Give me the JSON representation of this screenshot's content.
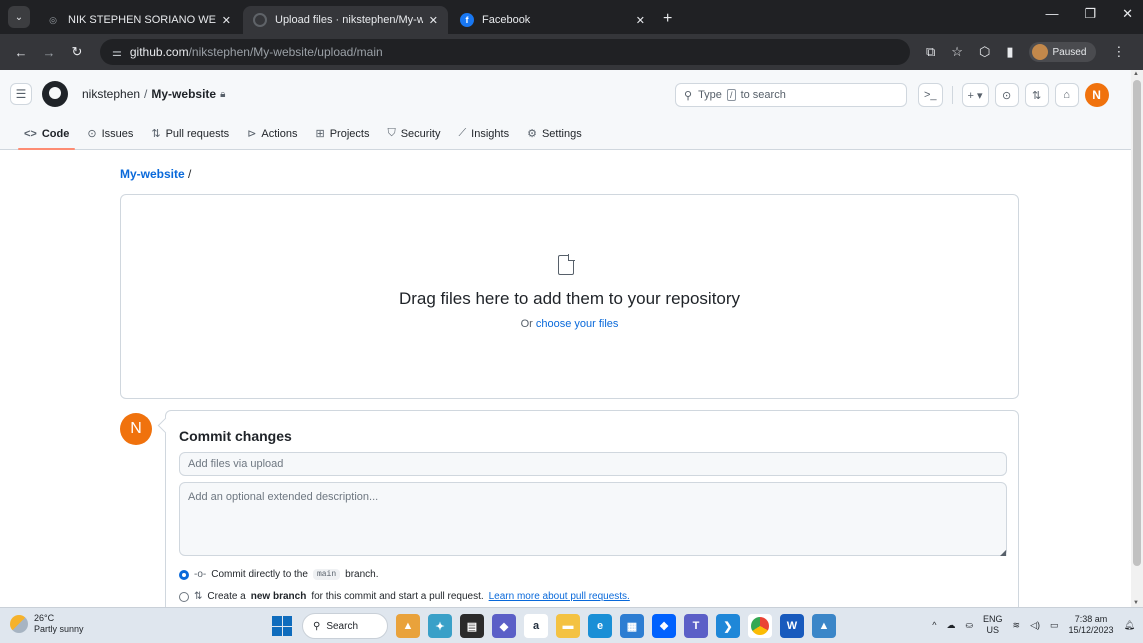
{
  "browser": {
    "tabs": [
      {
        "title": "NIK STEPHEN SORIANO WEBSI",
        "active": false
      },
      {
        "title": "Upload files · nikstephen/My-w",
        "active": true
      },
      {
        "title": "Facebook",
        "active": false
      }
    ],
    "url_host": "github.com",
    "url_path": "/nikstephen/My-website/upload/main",
    "profile_label": "Paused"
  },
  "github": {
    "owner": "nikstephen",
    "separator": "/",
    "repo": "My-website",
    "search_pre": "Type",
    "search_key": "/",
    "search_post": "to search",
    "avatar_initial": "N",
    "repo_tabs": [
      {
        "label": "Code",
        "icon": "code-icon"
      },
      {
        "label": "Issues",
        "icon": "issue-icon"
      },
      {
        "label": "Pull requests",
        "icon": "pull-request-icon"
      },
      {
        "label": "Actions",
        "icon": "play-icon"
      },
      {
        "label": "Projects",
        "icon": "table-icon"
      },
      {
        "label": "Security",
        "icon": "shield-icon"
      },
      {
        "label": "Insights",
        "icon": "graph-icon"
      },
      {
        "label": "Settings",
        "icon": "gear-icon"
      }
    ]
  },
  "upload": {
    "breadcrumb_repo": "My-website",
    "breadcrumb_sep": "/",
    "drop_title": "Drag files here to add them to your repository",
    "drop_sub_prefix": "Or",
    "drop_sub_link": "choose your files"
  },
  "commit": {
    "avatar_initial": "N",
    "title": "Commit changes",
    "summary_placeholder": "Add files via upload",
    "description_placeholder": "Add an optional extended description...",
    "option_direct_pre": "Commit directly to the",
    "option_direct_branch": "main",
    "option_direct_post": "branch.",
    "option_new_pre": "Create a",
    "option_new_bold": "new branch",
    "option_new_post": "for this commit and start a pull request.",
    "option_new_link": "Learn more about pull requests."
  },
  "taskbar": {
    "temperature": "26°C",
    "weather": "Partly sunny",
    "search_label": "Search",
    "lang_top": "ENG",
    "lang_bottom": "US",
    "time": "7:38 am",
    "date": "15/12/2023"
  }
}
